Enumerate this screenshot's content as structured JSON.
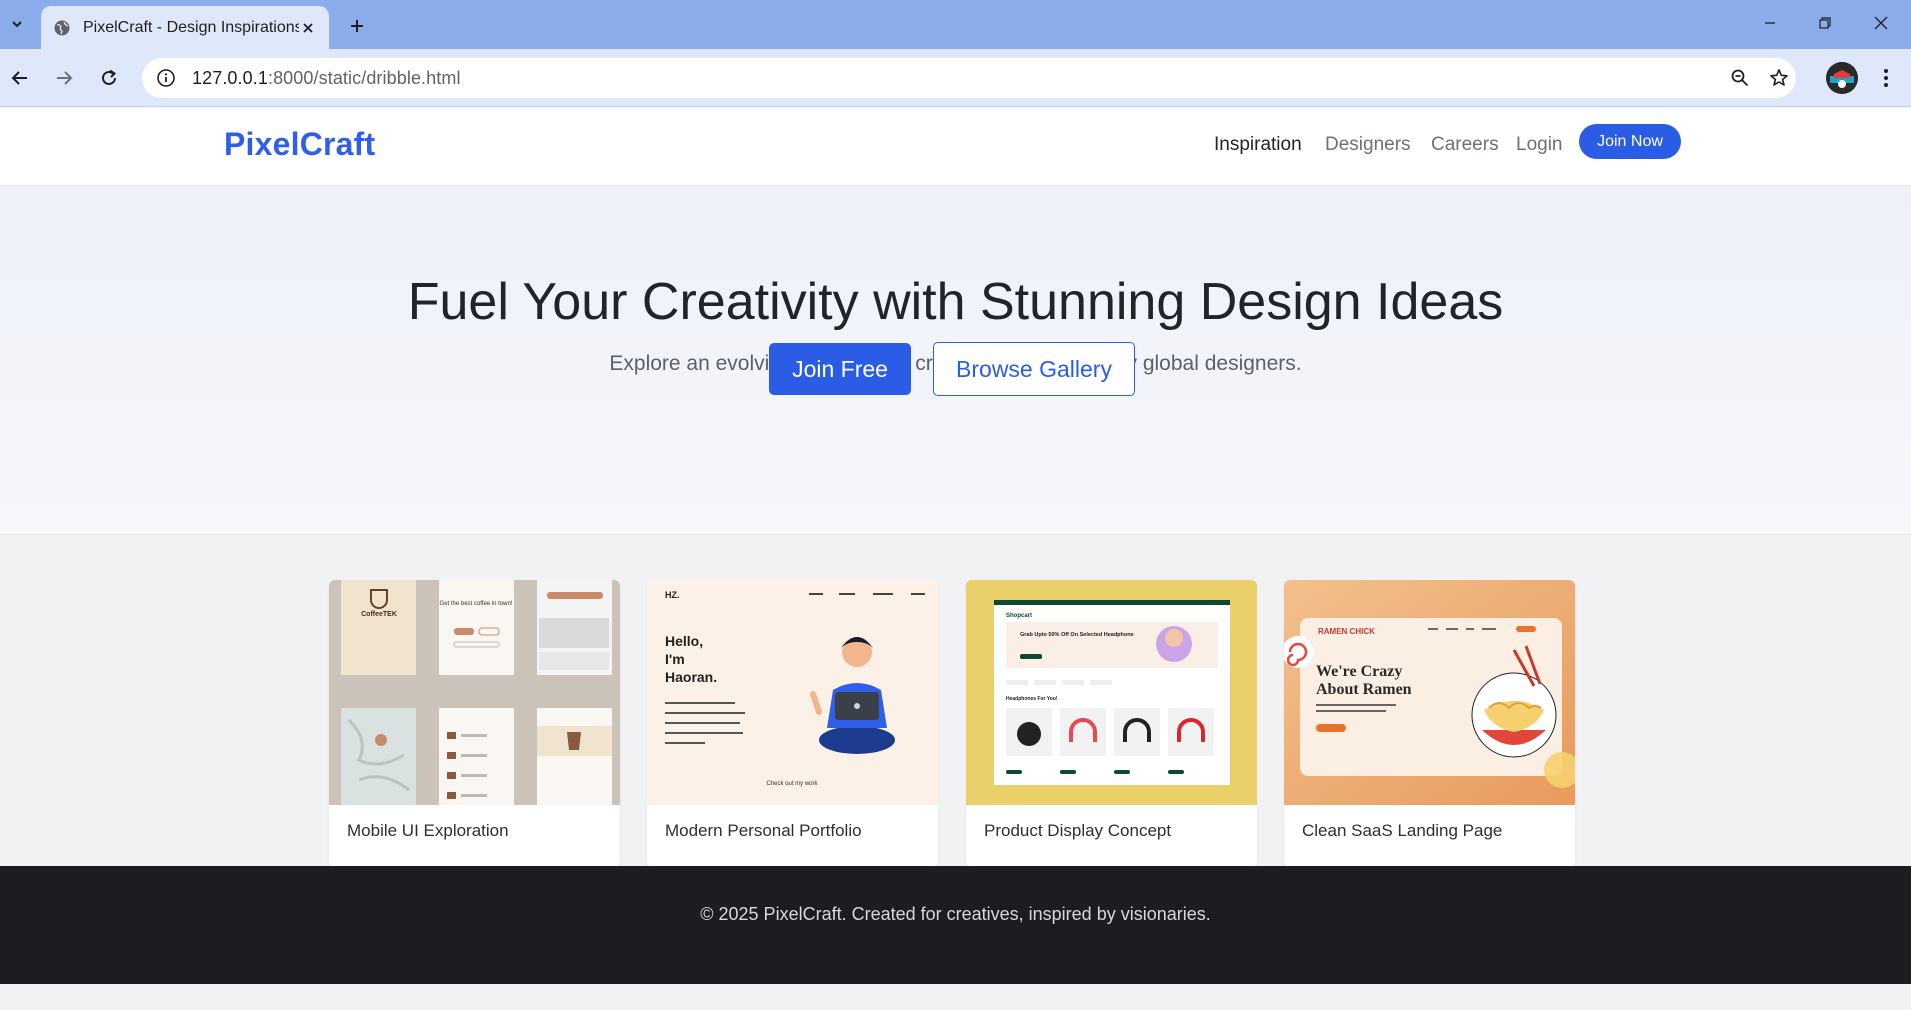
{
  "browser": {
    "tab_title": "PixelCraft - Design Inspirations",
    "url_host": "127.0.0.1",
    "url_rest": ":8000/static/dribble.html"
  },
  "site": {
    "brand": "PixelCraft",
    "nav": {
      "inspiration": "Inspiration",
      "designers": "Designers",
      "careers": "Careers",
      "login": "Login",
      "join_now": "Join Now"
    }
  },
  "hero": {
    "title": "Fuel Your Creativity with Stunning Design Ideas",
    "subtitle": "Explore an evolving collection of creative work shared by global designers.",
    "primary_cta": "Join Free",
    "secondary_cta": "Browse Gallery"
  },
  "gallery": {
    "cards": [
      {
        "title": "Mobile UI Exploration",
        "thumb": "coffee-app-screens"
      },
      {
        "title": "Modern Personal Portfolio",
        "thumb": "portfolio-hero"
      },
      {
        "title": "Product Display Concept",
        "thumb": "headphone-store"
      },
      {
        "title": "Clean SaaS Landing Page",
        "thumb": "ramen-landing"
      }
    ],
    "thumb_text": {
      "coffee_logo": "CoffeeTEK",
      "coffee_tagline": "Get the best coffee in town!",
      "portfolio_logo": "HZ.",
      "portfolio_headline": [
        "Hello,",
        "I'm",
        "Haoran."
      ],
      "portfolio_cta": "Check out my work",
      "store_logo": "Shopcart",
      "store_banner": "Grab Upto 50% Off On Selected Headphone",
      "store_section": "Headphones For You!",
      "ramen_logo": "RAMEN CHICK",
      "ramen_headline": [
        "We're Crazy",
        "About Ramen"
      ]
    }
  },
  "footer": {
    "text": "© 2025 PixelCraft. Created for creatives, inspired by visionaries."
  },
  "colors": {
    "brand": "#2f5fe8",
    "primary": "#2a5ce6",
    "footer_bg": "#1b1d21",
    "chrome_tabbar": "#8aacea"
  }
}
